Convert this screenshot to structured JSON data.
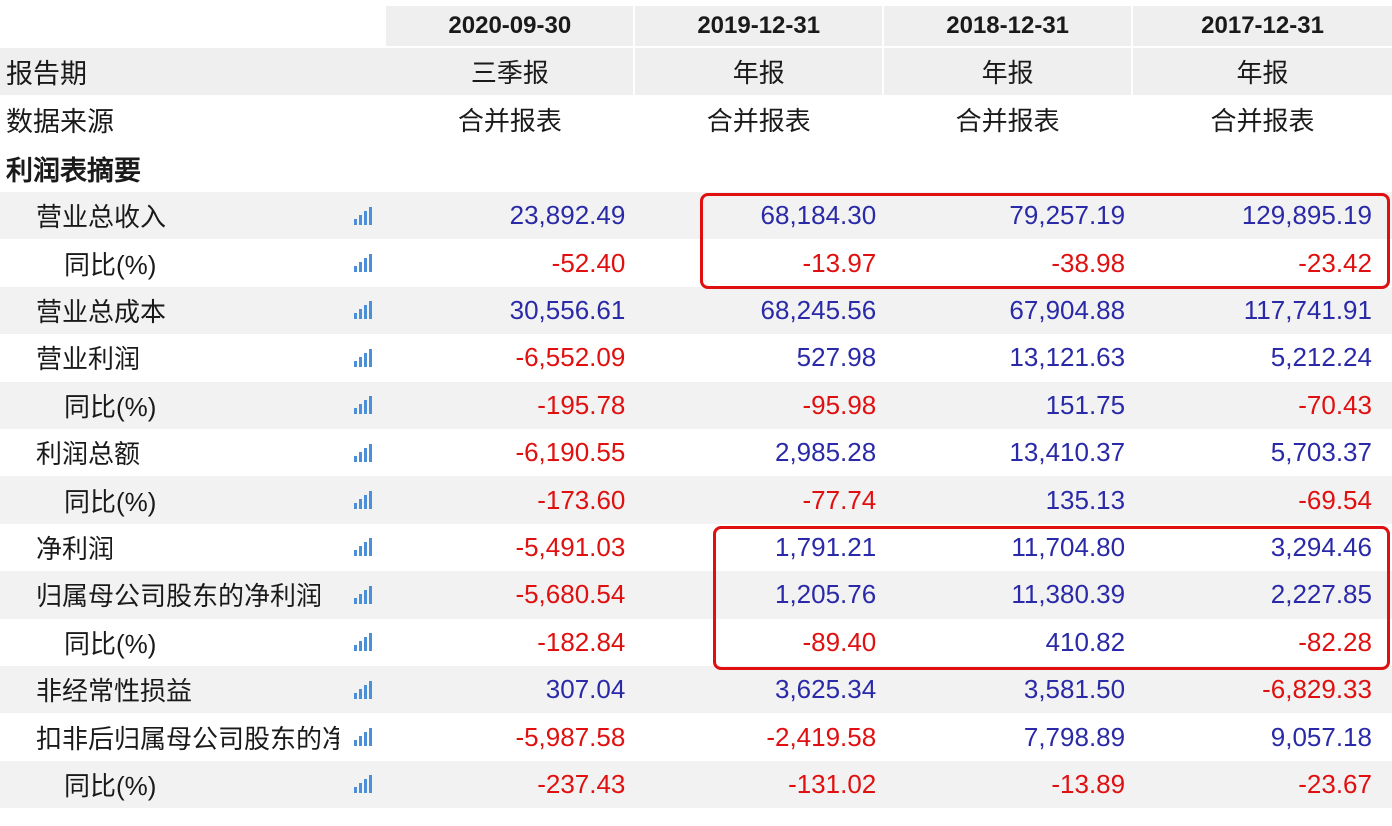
{
  "columns": [
    "2020-09-30",
    "2019-12-31",
    "2018-12-31",
    "2017-12-31"
  ],
  "report_period": {
    "label": "报告期",
    "values": [
      "三季报",
      "年报",
      "年报",
      "年报"
    ]
  },
  "data_source": {
    "label": "数据来源",
    "values": [
      "合并报表",
      "合并报表",
      "合并报表",
      "合并报表"
    ]
  },
  "section_title": "利润表摘要",
  "chart_icon": "bar-chart-icon",
  "colors": {
    "positive": "#2a2aa8",
    "negative": "#e01010",
    "highlight": "#e01010",
    "icon": "#4a8fd8"
  },
  "rows": [
    {
      "label": "营业总收入",
      "values": [
        "23,892.49",
        "68,184.30",
        "79,257.19",
        "129,895.19"
      ]
    },
    {
      "label": "同比(%)",
      "values": [
        "-52.40",
        "-13.97",
        "-38.98",
        "-23.42"
      ]
    },
    {
      "label": "营业总成本",
      "values": [
        "30,556.61",
        "68,245.56",
        "67,904.88",
        "117,741.91"
      ]
    },
    {
      "label": "营业利润",
      "values": [
        "-6,552.09",
        "527.98",
        "13,121.63",
        "5,212.24"
      ]
    },
    {
      "label": "同比(%)",
      "values": [
        "-195.78",
        "-95.98",
        "151.75",
        "-70.43"
      ]
    },
    {
      "label": "利润总额",
      "values": [
        "-6,190.55",
        "2,985.28",
        "13,410.37",
        "5,703.37"
      ]
    },
    {
      "label": "同比(%)",
      "values": [
        "-173.60",
        "-77.74",
        "135.13",
        "-69.54"
      ]
    },
    {
      "label": "净利润",
      "values": [
        "-5,491.03",
        "1,791.21",
        "11,704.80",
        "3,294.46"
      ]
    },
    {
      "label": "归属母公司股东的净利润",
      "values": [
        "-5,680.54",
        "1,205.76",
        "11,380.39",
        "2,227.85"
      ]
    },
    {
      "label": "同比(%)",
      "values": [
        "-182.84",
        "-89.40",
        "410.82",
        "-82.28"
      ]
    },
    {
      "label": "非经常性损益",
      "values": [
        "307.04",
        "3,625.34",
        "3,581.50",
        "-6,829.33"
      ]
    },
    {
      "label": "扣非后归属母公司股东的净利润",
      "values": [
        "-5,987.58",
        "-2,419.58",
        "7,798.89",
        "9,057.18"
      ]
    },
    {
      "label": "同比(%)",
      "values": [
        "-237.43",
        "-131.02",
        "-13.89",
        "-23.67"
      ]
    }
  ]
}
